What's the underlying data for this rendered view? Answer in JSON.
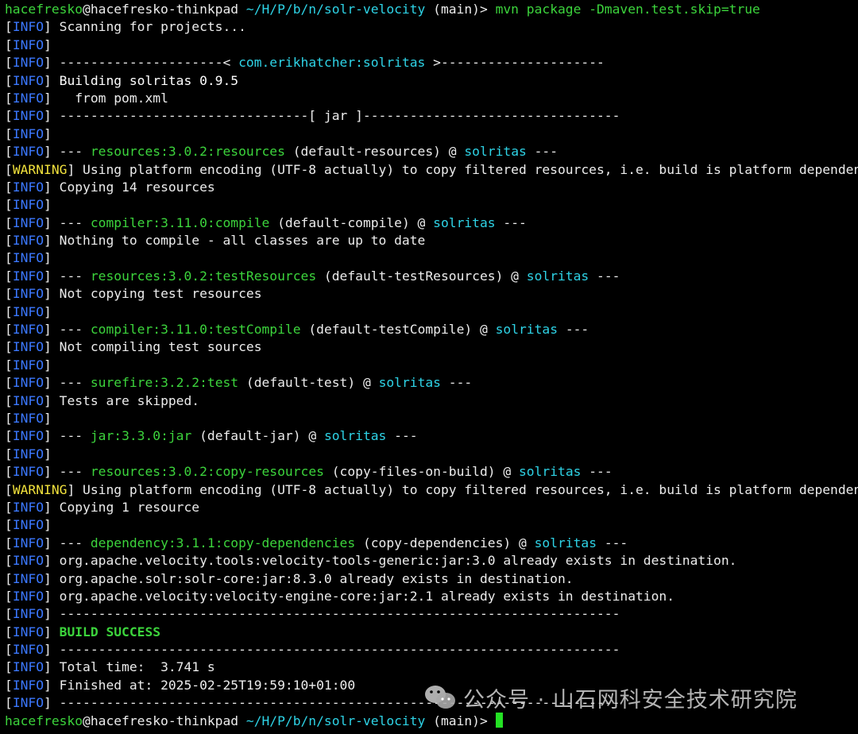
{
  "terminal": {
    "lines": [
      {
        "segs": [
          [
            "hacefresko",
            "green"
          ],
          [
            "@hacefresko-thinkpad ",
            "white"
          ],
          [
            "~/H/P/b/n/solr-velocity",
            "cyan"
          ],
          [
            " (main)> ",
            "white"
          ],
          [
            "mvn package -Dmaven.test.skip=true",
            "green"
          ]
        ]
      },
      {
        "segs": [
          [
            "[",
            "white"
          ],
          [
            "INFO",
            "blue"
          ],
          [
            "] Scanning for projects...",
            "white"
          ]
        ]
      },
      {
        "segs": [
          [
            "[",
            "white"
          ],
          [
            "INFO",
            "blue"
          ],
          [
            "]",
            "white"
          ]
        ]
      },
      {
        "segs": [
          [
            "[",
            "white"
          ],
          [
            "INFO",
            "blue"
          ],
          [
            "] ---------------------< ",
            "white"
          ],
          [
            "com.erikhatcher:solritas",
            "cyan"
          ],
          [
            " >---------------------",
            "white"
          ]
        ]
      },
      {
        "segs": [
          [
            "[",
            "white"
          ],
          [
            "INFO",
            "blue"
          ],
          [
            "] ",
            "white"
          ],
          [
            "Building solritas 0.9.5",
            "bright"
          ]
        ]
      },
      {
        "segs": [
          [
            "[",
            "white"
          ],
          [
            "INFO",
            "blue"
          ],
          [
            "]   from pom.xml",
            "white"
          ]
        ]
      },
      {
        "segs": [
          [
            "[",
            "white"
          ],
          [
            "INFO",
            "blue"
          ],
          [
            "] --------------------------------[ jar ]---------------------------------",
            "white"
          ]
        ]
      },
      {
        "segs": [
          [
            "[",
            "white"
          ],
          [
            "INFO",
            "blue"
          ],
          [
            "]",
            "white"
          ]
        ]
      },
      {
        "segs": [
          [
            "[",
            "white"
          ],
          [
            "INFO",
            "blue"
          ],
          [
            "] --- ",
            "white"
          ],
          [
            "resources:3.0.2:resources",
            "green"
          ],
          [
            " (default-resources) @ ",
            "white"
          ],
          [
            "solritas",
            "cyan"
          ],
          [
            " ---",
            "white"
          ]
        ]
      },
      {
        "segs": [
          [
            "[",
            "white"
          ],
          [
            "WARNING",
            "yellow"
          ],
          [
            "] Using platform encoding (UTF-8 actually) to copy filtered resources, i.e. build is platform dependent!",
            "white"
          ]
        ]
      },
      {
        "segs": [
          [
            "[",
            "white"
          ],
          [
            "INFO",
            "blue"
          ],
          [
            "] Copying 14 resources",
            "white"
          ]
        ]
      },
      {
        "segs": [
          [
            "[",
            "white"
          ],
          [
            "INFO",
            "blue"
          ],
          [
            "]",
            "white"
          ]
        ]
      },
      {
        "segs": [
          [
            "[",
            "white"
          ],
          [
            "INFO",
            "blue"
          ],
          [
            "] --- ",
            "white"
          ],
          [
            "compiler:3.11.0:compile",
            "green"
          ],
          [
            " (default-compile) @ ",
            "white"
          ],
          [
            "solritas",
            "cyan"
          ],
          [
            " ---",
            "white"
          ]
        ]
      },
      {
        "segs": [
          [
            "[",
            "white"
          ],
          [
            "INFO",
            "blue"
          ],
          [
            "] Nothing to compile - all classes are up to date",
            "white"
          ]
        ]
      },
      {
        "segs": [
          [
            "[",
            "white"
          ],
          [
            "INFO",
            "blue"
          ],
          [
            "]",
            "white"
          ]
        ]
      },
      {
        "segs": [
          [
            "[",
            "white"
          ],
          [
            "INFO",
            "blue"
          ],
          [
            "] --- ",
            "white"
          ],
          [
            "resources:3.0.2:testResources",
            "green"
          ],
          [
            " (default-testResources) @ ",
            "white"
          ],
          [
            "solritas",
            "cyan"
          ],
          [
            " ---",
            "white"
          ]
        ]
      },
      {
        "segs": [
          [
            "[",
            "white"
          ],
          [
            "INFO",
            "blue"
          ],
          [
            "] Not copying test resources",
            "white"
          ]
        ]
      },
      {
        "segs": [
          [
            "[",
            "white"
          ],
          [
            "INFO",
            "blue"
          ],
          [
            "]",
            "white"
          ]
        ]
      },
      {
        "segs": [
          [
            "[",
            "white"
          ],
          [
            "INFO",
            "blue"
          ],
          [
            "] --- ",
            "white"
          ],
          [
            "compiler:3.11.0:testCompile",
            "green"
          ],
          [
            " (default-testCompile) @ ",
            "white"
          ],
          [
            "solritas",
            "cyan"
          ],
          [
            " ---",
            "white"
          ]
        ]
      },
      {
        "segs": [
          [
            "[",
            "white"
          ],
          [
            "INFO",
            "blue"
          ],
          [
            "] Not compiling test sources",
            "white"
          ]
        ]
      },
      {
        "segs": [
          [
            "[",
            "white"
          ],
          [
            "INFO",
            "blue"
          ],
          [
            "]",
            "white"
          ]
        ]
      },
      {
        "segs": [
          [
            "[",
            "white"
          ],
          [
            "INFO",
            "blue"
          ],
          [
            "] --- ",
            "white"
          ],
          [
            "surefire:3.2.2:test",
            "green"
          ],
          [
            " (default-test) @ ",
            "white"
          ],
          [
            "solritas",
            "cyan"
          ],
          [
            " ---",
            "white"
          ]
        ]
      },
      {
        "segs": [
          [
            "[",
            "white"
          ],
          [
            "INFO",
            "blue"
          ],
          [
            "] Tests are skipped.",
            "white"
          ]
        ]
      },
      {
        "segs": [
          [
            "[",
            "white"
          ],
          [
            "INFO",
            "blue"
          ],
          [
            "]",
            "white"
          ]
        ]
      },
      {
        "segs": [
          [
            "[",
            "white"
          ],
          [
            "INFO",
            "blue"
          ],
          [
            "] --- ",
            "white"
          ],
          [
            "jar:3.3.0:jar",
            "green"
          ],
          [
            " (default-jar) @ ",
            "white"
          ],
          [
            "solritas",
            "cyan"
          ],
          [
            " ---",
            "white"
          ]
        ]
      },
      {
        "segs": [
          [
            "[",
            "white"
          ],
          [
            "INFO",
            "blue"
          ],
          [
            "]",
            "white"
          ]
        ]
      },
      {
        "segs": [
          [
            "[",
            "white"
          ],
          [
            "INFO",
            "blue"
          ],
          [
            "] --- ",
            "white"
          ],
          [
            "resources:3.0.2:copy-resources",
            "green"
          ],
          [
            " (copy-files-on-build) @ ",
            "white"
          ],
          [
            "solritas",
            "cyan"
          ],
          [
            " ---",
            "white"
          ]
        ]
      },
      {
        "segs": [
          [
            "[",
            "white"
          ],
          [
            "WARNING",
            "yellow"
          ],
          [
            "] Using platform encoding (UTF-8 actually) to copy filtered resources, i.e. build is platform dependent!",
            "white"
          ]
        ]
      },
      {
        "segs": [
          [
            "[",
            "white"
          ],
          [
            "INFO",
            "blue"
          ],
          [
            "] Copying 1 resource",
            "white"
          ]
        ]
      },
      {
        "segs": [
          [
            "[",
            "white"
          ],
          [
            "INFO",
            "blue"
          ],
          [
            "]",
            "white"
          ]
        ]
      },
      {
        "segs": [
          [
            "[",
            "white"
          ],
          [
            "INFO",
            "blue"
          ],
          [
            "] --- ",
            "white"
          ],
          [
            "dependency:3.1.1:copy-dependencies",
            "green"
          ],
          [
            " (copy-dependencies) @ ",
            "white"
          ],
          [
            "solritas",
            "cyan"
          ],
          [
            " ---",
            "white"
          ]
        ]
      },
      {
        "segs": [
          [
            "[",
            "white"
          ],
          [
            "INFO",
            "blue"
          ],
          [
            "] org.apache.velocity.tools:velocity-tools-generic:jar:3.0 already exists in destination.",
            "white"
          ]
        ]
      },
      {
        "segs": [
          [
            "[",
            "white"
          ],
          [
            "INFO",
            "blue"
          ],
          [
            "] org.apache.solr:solr-core:jar:8.3.0 already exists in destination.",
            "white"
          ]
        ]
      },
      {
        "segs": [
          [
            "[",
            "white"
          ],
          [
            "INFO",
            "blue"
          ],
          [
            "] org.apache.velocity:velocity-engine-core:jar:2.1 already exists in destination.",
            "white"
          ]
        ]
      },
      {
        "segs": [
          [
            "[",
            "white"
          ],
          [
            "INFO",
            "blue"
          ],
          [
            "] ------------------------------------------------------------------------",
            "white"
          ]
        ]
      },
      {
        "segs": [
          [
            "[",
            "white"
          ],
          [
            "INFO",
            "blue"
          ],
          [
            "] ",
            "white"
          ],
          [
            "BUILD SUCCESS",
            "boldgreen"
          ]
        ]
      },
      {
        "segs": [
          [
            "[",
            "white"
          ],
          [
            "INFO",
            "blue"
          ],
          [
            "] ------------------------------------------------------------------------",
            "white"
          ]
        ]
      },
      {
        "segs": [
          [
            "[",
            "white"
          ],
          [
            "INFO",
            "blue"
          ],
          [
            "] Total time:  3.741 s",
            "white"
          ]
        ]
      },
      {
        "segs": [
          [
            "[",
            "white"
          ],
          [
            "INFO",
            "blue"
          ],
          [
            "] Finished at: 2025-02-25T19:59:10+01:00",
            "white"
          ]
        ]
      },
      {
        "segs": [
          [
            "[",
            "white"
          ],
          [
            "INFO",
            "blue"
          ],
          [
            "] ------------------------------------------------------------------------",
            "white"
          ]
        ]
      },
      {
        "segs": [
          [
            "hacefresko",
            "green"
          ],
          [
            "@hacefresko-thinkpad ",
            "white"
          ],
          [
            "~/H/P/b/n/solr-velocity",
            "cyan"
          ],
          [
            " (main)> ",
            "white"
          ]
        ],
        "cursor": true
      }
    ]
  },
  "watermark": {
    "text": "公众号 · 山石网科安全技术研究院",
    "icon": "wechat-icon"
  },
  "colors": {
    "background": "#000000",
    "text": "#ececec",
    "info_tag": "#3b78ff",
    "highlight_green": "#3cd43c",
    "highlight_cyan": "#2ed3e6",
    "warning_tag": "#f2e23c",
    "cursor": "#24e224"
  }
}
